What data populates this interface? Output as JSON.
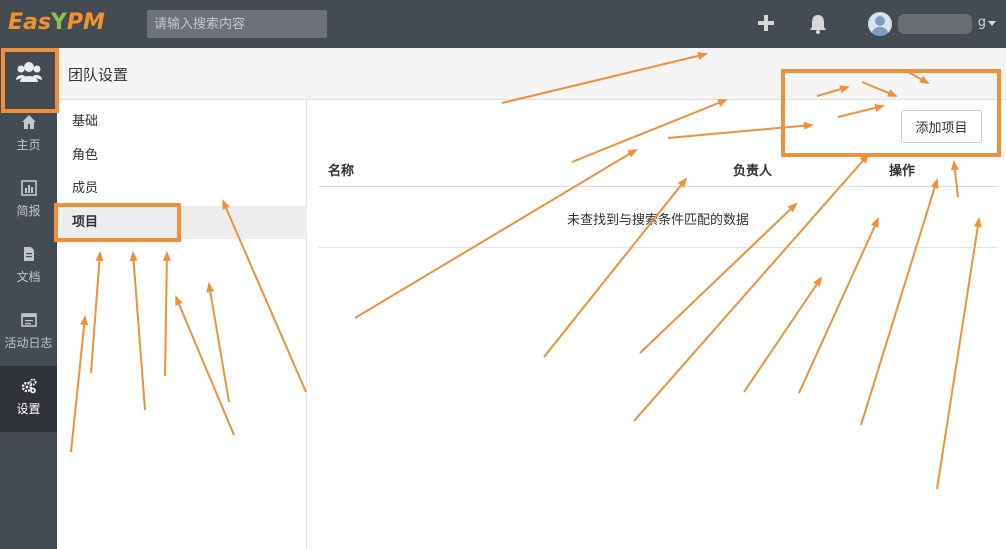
{
  "topbar": {
    "logo_prefix": "Eas",
    "logo_leaf": "Y",
    "logo_suffix": "PM",
    "search_placeholder": "请输入搜索内容",
    "add_icon": "plus-icon",
    "bell_icon": "bell-icon",
    "user_name_suffix": "g"
  },
  "leftnav": {
    "team_icon": "team-users-icon",
    "items": [
      {
        "label": "主页",
        "icon": "home-icon"
      },
      {
        "label": "简报",
        "icon": "bar-chart-icon"
      },
      {
        "label": "文档",
        "icon": "document-icon"
      },
      {
        "label": "活动日志",
        "icon": "activity-log-icon"
      },
      {
        "label": "设置",
        "icon": "gears-icon",
        "active": true
      }
    ]
  },
  "header": {
    "title": "团队设置"
  },
  "submenu": {
    "items": [
      {
        "label": "基础"
      },
      {
        "label": "角色"
      },
      {
        "label": "成员"
      },
      {
        "label": "项目",
        "active": true
      }
    ]
  },
  "main": {
    "add_button": "添加项目",
    "columns": [
      "名称",
      "负责人",
      "操作"
    ],
    "empty_text": "未查找到与搜索条件匹配的数据"
  },
  "colors": {
    "nav_bg": "#454b53",
    "nav_active_bg": "#2f3337",
    "annotation_orange": "#f0903a"
  }
}
